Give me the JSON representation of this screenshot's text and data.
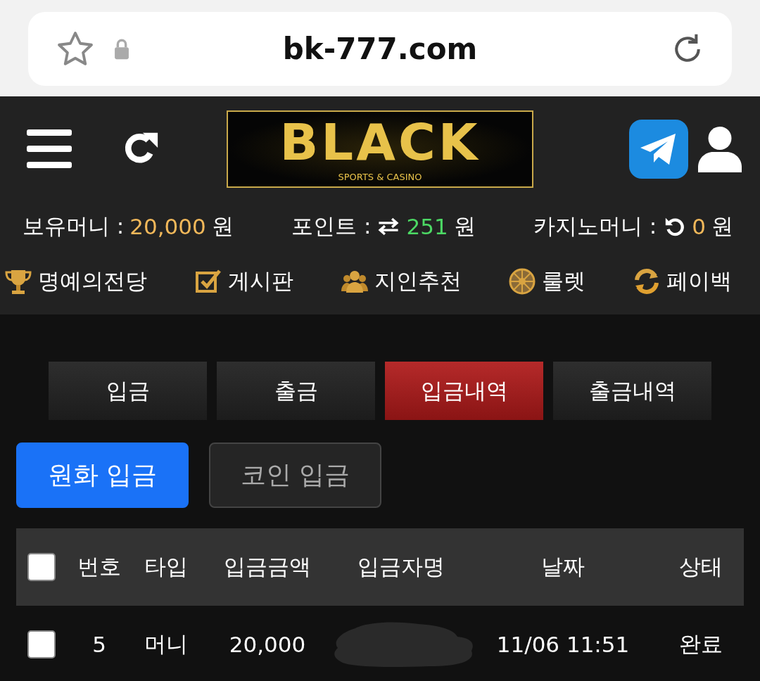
{
  "browser": {
    "url": "bk-777.com"
  },
  "logo": {
    "title": "BLACK",
    "subtitle": "SPORTS & CASINO"
  },
  "balances": [
    {
      "label": "보유머니 :",
      "value": "20,000",
      "unit": "원",
      "color": "#f2b85a"
    },
    {
      "label": "포인트 :",
      "value": "251",
      "unit": "원",
      "color": "#4cd964"
    },
    {
      "label": "카지노머니 :",
      "value": "0",
      "unit": "원",
      "color": "#f2b85a"
    }
  ],
  "menu": [
    {
      "label": "명예의전당"
    },
    {
      "label": "게시판"
    },
    {
      "label": "지인추천"
    },
    {
      "label": "룰렛"
    },
    {
      "label": "페이백"
    }
  ],
  "tabs": [
    {
      "label": "입금",
      "selected": false
    },
    {
      "label": "출금",
      "selected": false
    },
    {
      "label": "입금내역",
      "selected": true
    },
    {
      "label": "출금내역",
      "selected": false
    }
  ],
  "subtabs": [
    {
      "label": "원화 입금",
      "selected": true
    },
    {
      "label": "코인 입금",
      "selected": false
    }
  ],
  "table": {
    "header_checked": false,
    "columns": [
      "번호",
      "타입",
      "입금금액",
      "입금자명",
      "날짜",
      "상태"
    ],
    "rows": [
      {
        "checked": false,
        "cells": [
          {
            "text": "5"
          },
          {
            "text": "머니"
          },
          {
            "text": "20,000"
          },
          {
            "kind": "redacted"
          },
          {
            "text": "11/06 11:51"
          },
          {
            "text": "완료"
          }
        ]
      }
    ]
  }
}
